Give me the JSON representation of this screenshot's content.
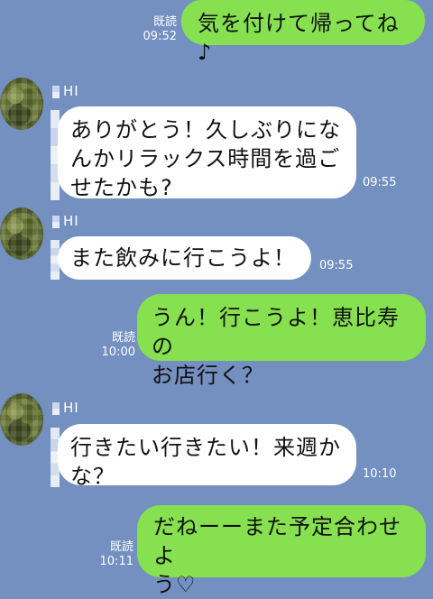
{
  "contact": {
    "name": "HI"
  },
  "labels": {
    "read": "既読"
  },
  "colors": {
    "background": "#7390c0",
    "mine_bubble": "#86e04f",
    "their_bubble": "#ffffff"
  },
  "messages": [
    {
      "from": "me",
      "text": "気を付けて帰ってね♪",
      "time": "09:52",
      "read": "既読"
    },
    {
      "from": "them",
      "text": "ありがとう！久しぶりにな\nんかリラックス時間を過ご\nせたかも?",
      "time": "09:55"
    },
    {
      "from": "them",
      "text": "また飲みに行こうよ！",
      "time": "09:55"
    },
    {
      "from": "me",
      "text": "うん！行こうよ！恵比寿の\nお店行く？",
      "time": "10:00",
      "read": "既読"
    },
    {
      "from": "them",
      "text": "行きたい行きたい！来週か\nな？",
      "time": "10:10"
    },
    {
      "from": "me",
      "text": "だねーーまた予定合わせよ\nう♡",
      "time": "10:11",
      "read": "既読"
    }
  ]
}
